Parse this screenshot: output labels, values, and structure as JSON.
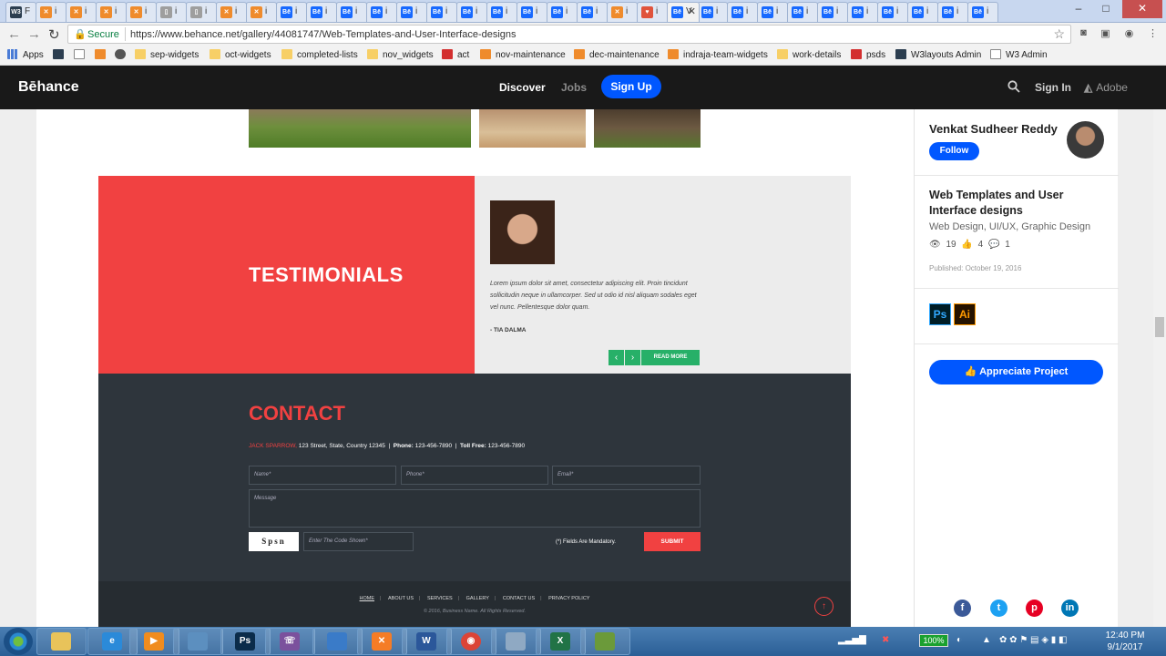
{
  "browser": {
    "tabs": [
      {
        "icon": "w3-icon",
        "text": "F"
      },
      {
        "icon": "xampp-icon",
        "text": "i"
      },
      {
        "icon": "xampp-icon",
        "text": "i"
      },
      {
        "icon": "xampp-icon",
        "text": "i"
      },
      {
        "icon": "xampp-icon",
        "text": "i"
      },
      {
        "icon": "page-icon",
        "text": "i"
      },
      {
        "icon": "page-icon",
        "text": "i"
      },
      {
        "icon": "xampp-icon",
        "text": "i"
      },
      {
        "icon": "xampp-icon",
        "text": "i"
      },
      {
        "icon": "behance-icon",
        "text": "i"
      },
      {
        "icon": "behance-icon",
        "text": "i"
      },
      {
        "icon": "behance-icon",
        "text": "i"
      },
      {
        "icon": "behance-icon",
        "text": "i"
      },
      {
        "icon": "behance-icon",
        "text": "i"
      },
      {
        "icon": "behance-icon",
        "text": "i"
      },
      {
        "icon": "behance-icon",
        "text": "i"
      },
      {
        "icon": "behance-icon",
        "text": "i"
      },
      {
        "icon": "behance-icon",
        "text": "i"
      },
      {
        "icon": "behance-icon",
        "text": "i"
      },
      {
        "icon": "behance-icon",
        "text": "i"
      },
      {
        "icon": "xampp-icon",
        "text": "i"
      },
      {
        "icon": "heart-icon",
        "text": "i"
      },
      {
        "icon": "behance-icon",
        "text": "V"
      },
      {
        "icon": "behance-icon",
        "text": "i"
      },
      {
        "icon": "behance-icon",
        "text": "i"
      },
      {
        "icon": "behance-icon",
        "text": "i"
      },
      {
        "icon": "behance-icon",
        "text": "i"
      },
      {
        "icon": "behance-icon",
        "text": "i"
      },
      {
        "icon": "behance-icon",
        "text": "i"
      },
      {
        "icon": "behance-icon",
        "text": "i"
      },
      {
        "icon": "behance-icon",
        "text": "i"
      },
      {
        "icon": "behance-icon",
        "text": "i"
      },
      {
        "icon": "behance-icon",
        "text": "i"
      }
    ],
    "secure_label": "Secure",
    "url": "https://www.behance.net/gallery/44081747/Web-Templates-and-User-Interface-designs",
    "bookmarks": [
      "Apps",
      "sep-widgets",
      "oct-widgets",
      "completed-lists",
      "nov_widgets",
      "act",
      "nov-maintenance",
      "dec-maintenance",
      "indraja-team-widgets",
      "work-details",
      "psds",
      "W3layouts Admin",
      "W3 Admin"
    ]
  },
  "behance": {
    "logo": "Bēhance",
    "discover": "Discover",
    "jobs": "Jobs",
    "signup": "Sign Up",
    "signin": "Sign In",
    "adobe": "Adobe"
  },
  "template": {
    "testimonials_title": "TESTIMONIALS",
    "quote": "Lorem ipsum dolor sit amet, consectetur adipiscing elit. Proin tincidunt sollicitudin neque in ullamcorper. Sed ut odio id nisl aliquam sodales eget vel nunc. Pellentesque dolor quam.",
    "author": "- TIA DALMA",
    "prev": "‹",
    "next": "›",
    "read_more": "READ MORE",
    "contact_title": "CONTACT",
    "contact_name": "JACK SPARROW,",
    "contact_address": "123 Street, State, Country 12345",
    "phone_label": "Phone:",
    "phone": "123-456-7890",
    "tollfree_label": "Toll Free:",
    "tollfree": "123-456-7890",
    "name_placeholder": "Name*",
    "phone_placeholder": "Phone*",
    "email_placeholder": "Email*",
    "message_placeholder": "Message",
    "captcha": "Spsn",
    "code_placeholder": "Enter The Code Shown*",
    "mandatory": "(*) Fields Are Mandatory.",
    "submit": "SUBMIT",
    "footer_links": [
      "HOME",
      "ABOUT US",
      "SERVICES",
      "GALLERY",
      "CONTACT US",
      "PRIVACY POLICY"
    ],
    "copyright": "© 2016, Business Name. All Rights Reserved."
  },
  "panel": {
    "owner": "Venkat Sudheer Reddy",
    "follow": "Follow",
    "title": "Web Templates and User Interface designs",
    "fields": "Web Design, UI/UX, Graphic Design",
    "views": "19",
    "appreciations": "4",
    "comments": "1",
    "published": "Published: October 19, 2016",
    "tools": [
      "Ps",
      "Ai"
    ],
    "appreciate": "Appreciate Project",
    "social": [
      "facebook",
      "twitter",
      "pinterest",
      "linkedin"
    ]
  },
  "taskbar": {
    "battery": "100%",
    "time": "12:40 PM",
    "date": "9/1/2017"
  },
  "colors": {
    "behance_blue": "#0057ff",
    "testimonial_red": "#f14141",
    "contact_dark": "#2e353c",
    "green": "#27b068"
  }
}
